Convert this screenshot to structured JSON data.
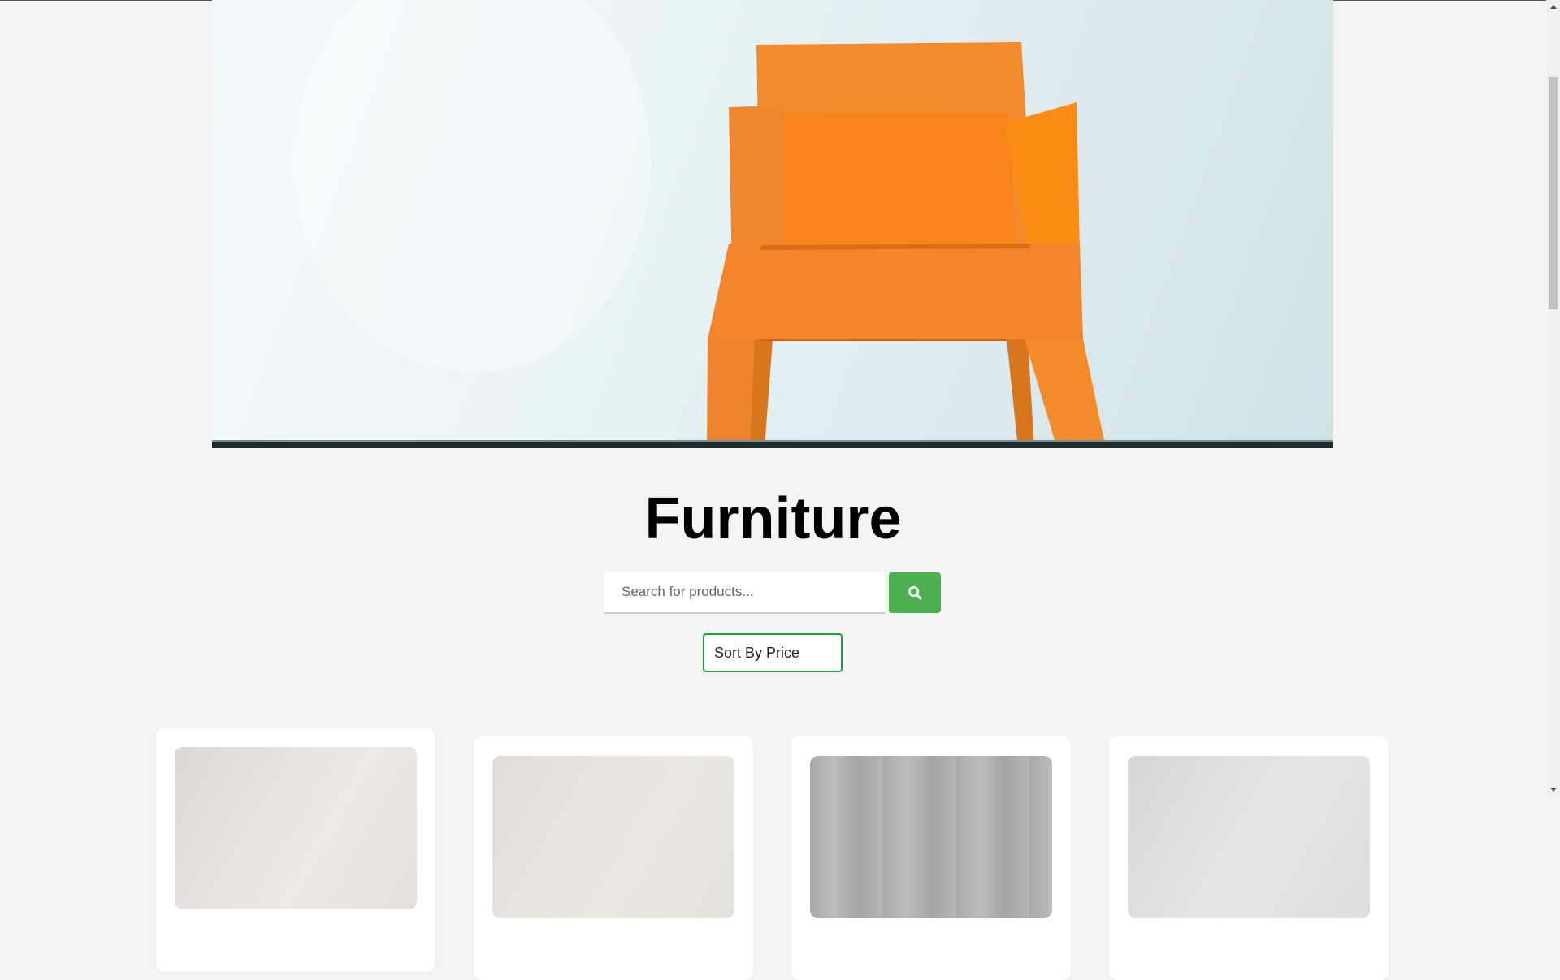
{
  "page": {
    "title": "Furniture"
  },
  "search": {
    "placeholder": "Search for products...",
    "value": "",
    "button_icon": "search-icon",
    "button_color": "#4caf50"
  },
  "sort": {
    "selected": "Sort By Price",
    "border_color": "#1e9e3a"
  },
  "hero": {
    "image": "orange-chair-photo",
    "accent": "#ff7f1a"
  },
  "products": [
    {
      "image": "product-image-1"
    },
    {
      "image": "product-image-2"
    },
    {
      "image": "product-image-3"
    },
    {
      "image": "product-image-4"
    }
  ]
}
